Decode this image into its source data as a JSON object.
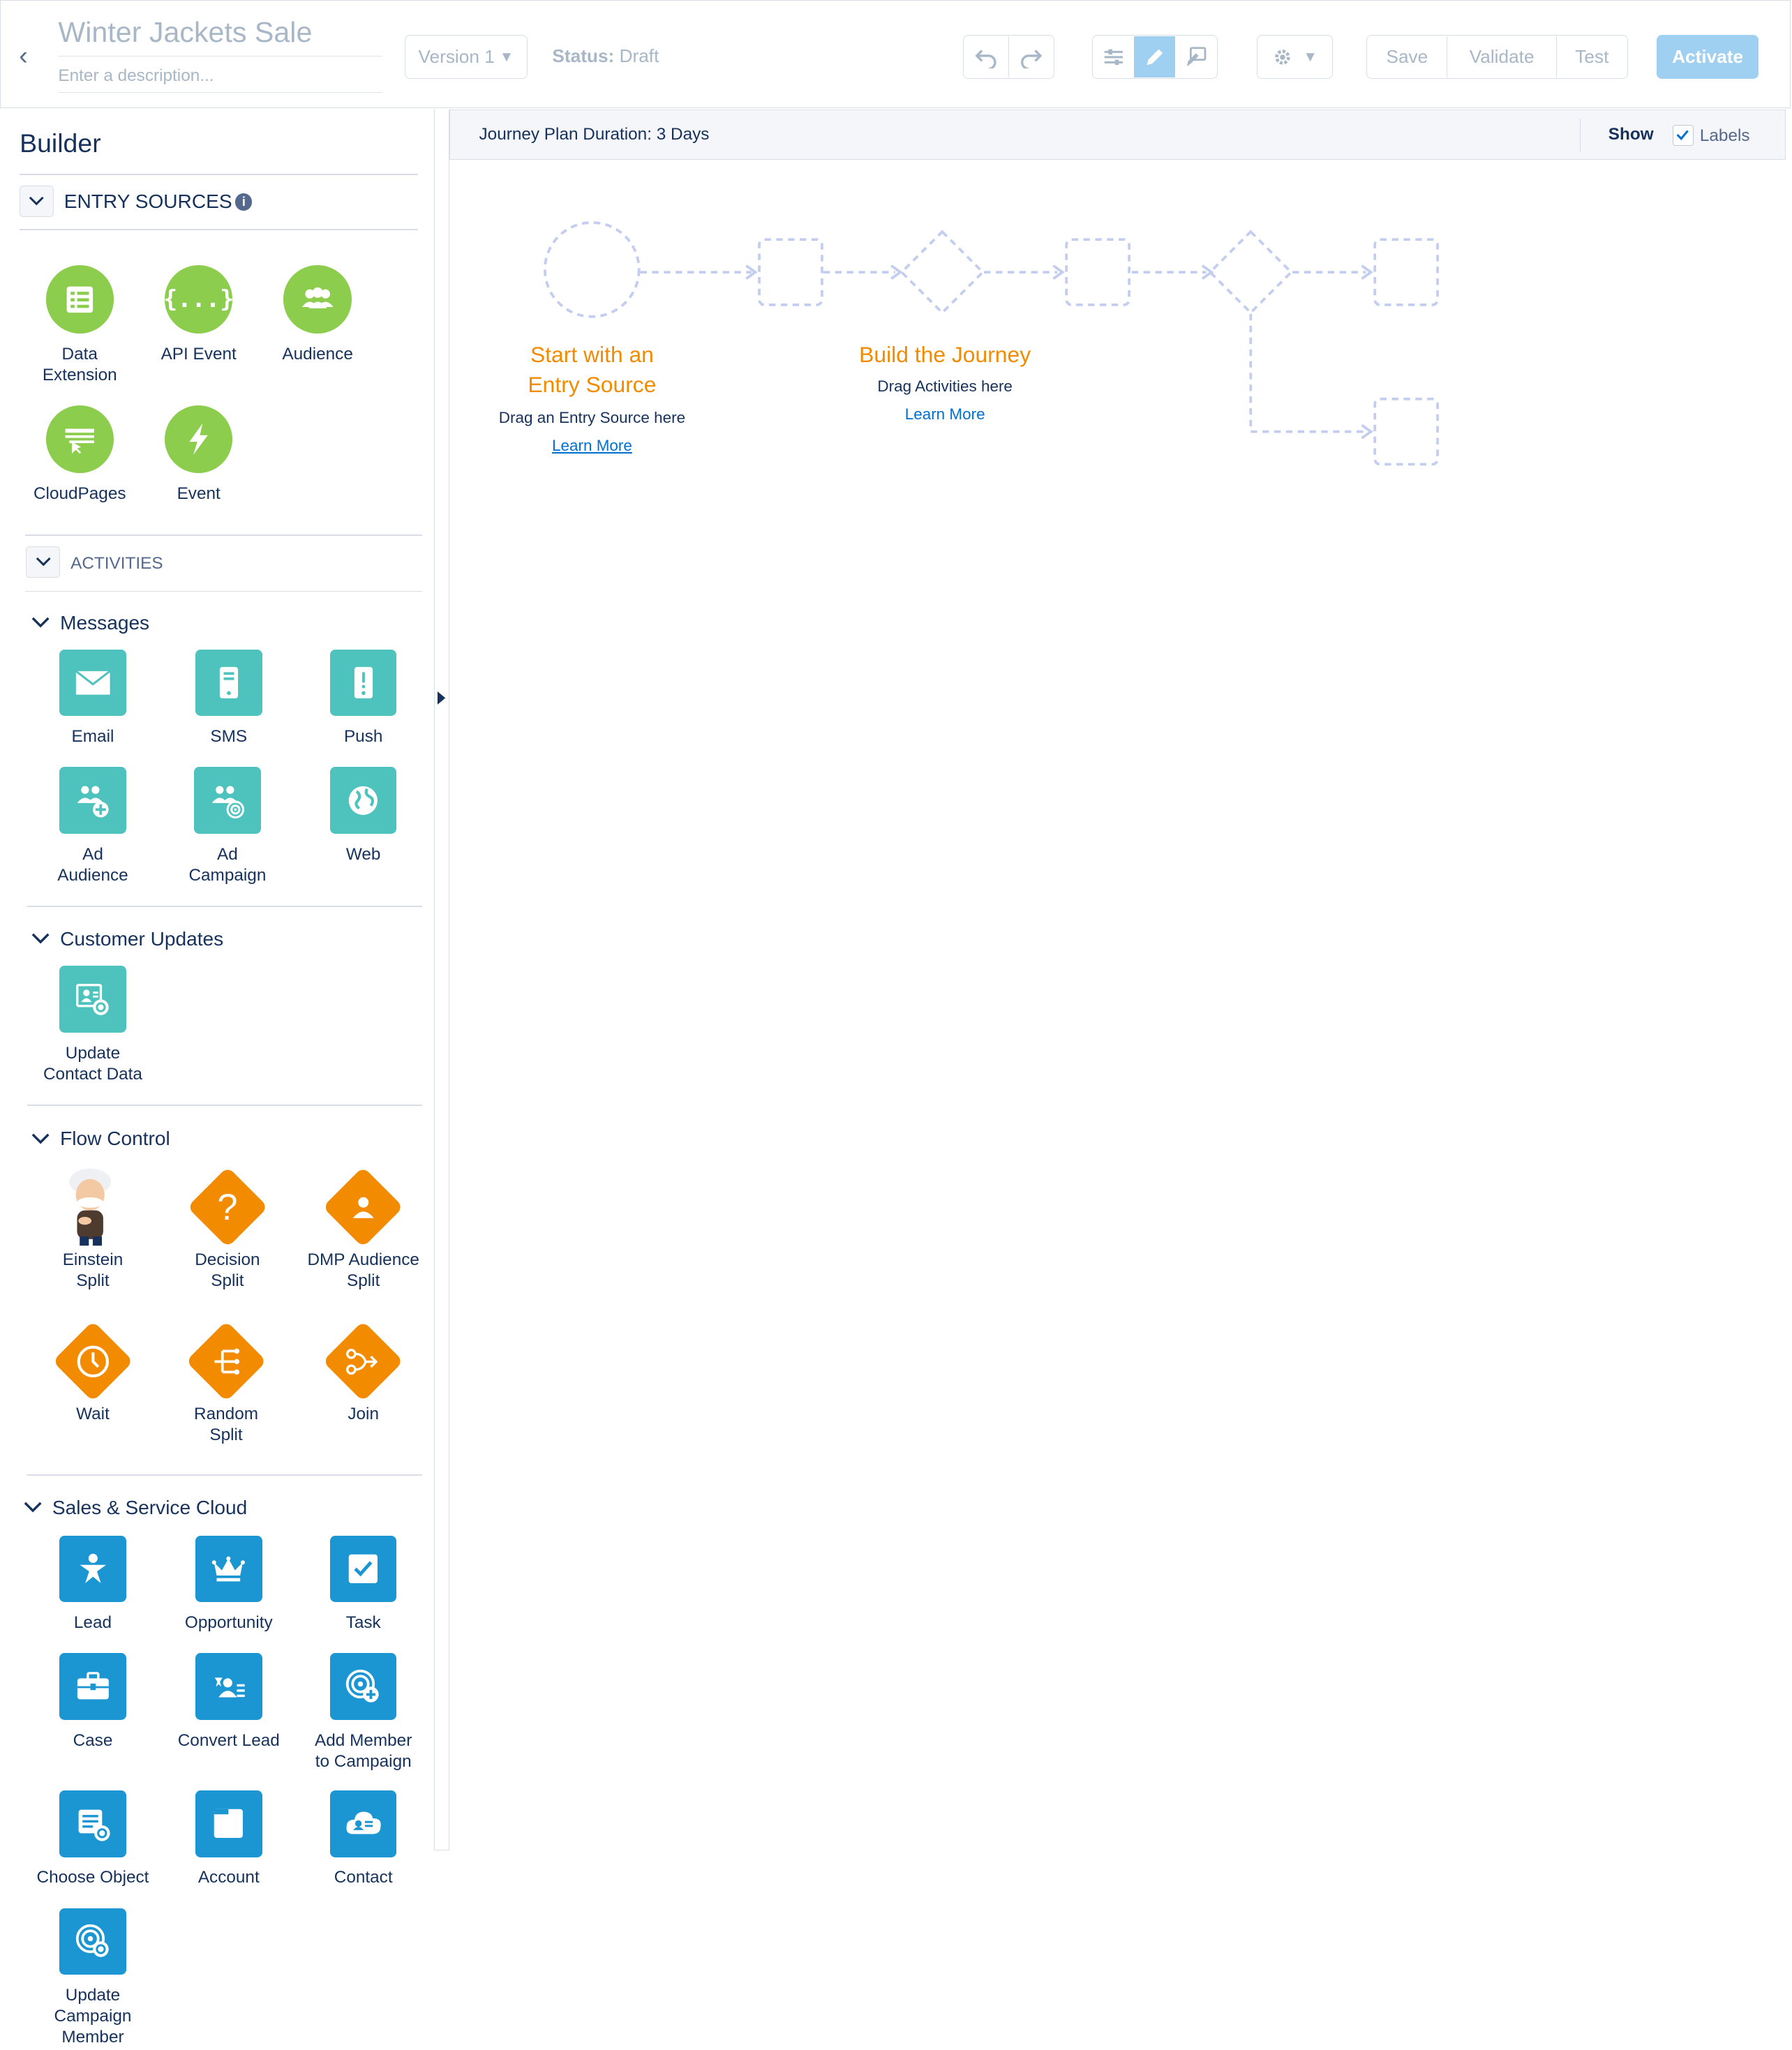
{
  "header": {
    "title": "Winter Jackets Sale",
    "description_placeholder": "Enter a description...",
    "version_label": "Version 1",
    "status_label": "Status:",
    "status_value": "Draft",
    "save_label": "Save",
    "validate_label": "Validate",
    "test_label": "Test",
    "activate_label": "Activate"
  },
  "sidebar": {
    "title": "Builder",
    "entry_sources": {
      "heading": "ENTRY SOURCES",
      "items": [
        {
          "label": "Data\nExtension",
          "icon": "data-extension-icon"
        },
        {
          "label": "API Event",
          "icon": "api-event-icon"
        },
        {
          "label": "Audience",
          "icon": "audience-icon"
        },
        {
          "label": "CloudPages",
          "icon": "cloudpages-icon"
        },
        {
          "label": "Event",
          "icon": "event-icon"
        }
      ]
    },
    "activities": {
      "heading": "ACTIVITIES",
      "messages": {
        "heading": "Messages",
        "items": [
          {
            "label": "Email"
          },
          {
            "label": "SMS"
          },
          {
            "label": "Push"
          },
          {
            "label": "Ad\nAudience"
          },
          {
            "label": "Ad\nCampaign"
          },
          {
            "label": "Web"
          }
        ]
      },
      "customer_updates": {
        "heading": "Customer Updates",
        "items": [
          {
            "label": "Update\nContact Data"
          }
        ]
      },
      "flow_control": {
        "heading": "Flow Control",
        "items": [
          {
            "label": "Einstein\nSplit"
          },
          {
            "label": "Decision\nSplit"
          },
          {
            "label": "DMP Audience\nSplit"
          },
          {
            "label": "Wait"
          },
          {
            "label": "Random\nSplit"
          },
          {
            "label": "Join"
          }
        ]
      },
      "sales_service": {
        "heading": "Sales & Service Cloud",
        "items": [
          {
            "label": "Lead"
          },
          {
            "label": "Opportunity"
          },
          {
            "label": "Task"
          },
          {
            "label": "Case"
          },
          {
            "label": "Convert Lead"
          },
          {
            "label": "Add Member\nto Campaign"
          },
          {
            "label": "Choose Object"
          },
          {
            "label": "Account"
          },
          {
            "label": "Contact"
          },
          {
            "label": "Update\nCampaign\nMember"
          }
        ]
      }
    }
  },
  "canvas": {
    "plan_duration": "Journey Plan Duration: 3 Days",
    "show_label": "Show",
    "labels_label": "Labels",
    "labels_checked": true,
    "entry_title": "Start with an\nEntry Source",
    "entry_hint": "Drag an Entry Source here",
    "entry_link": "Learn More",
    "build_title": "Build the Journey",
    "build_hint": "Drag Activities here",
    "build_link": "Learn More"
  },
  "colors": {
    "green": "#8ccd4e",
    "teal": "#4ec2bd",
    "orange": "#f28b00",
    "blue": "#1b96d3",
    "activate": "#9fd0f2"
  }
}
